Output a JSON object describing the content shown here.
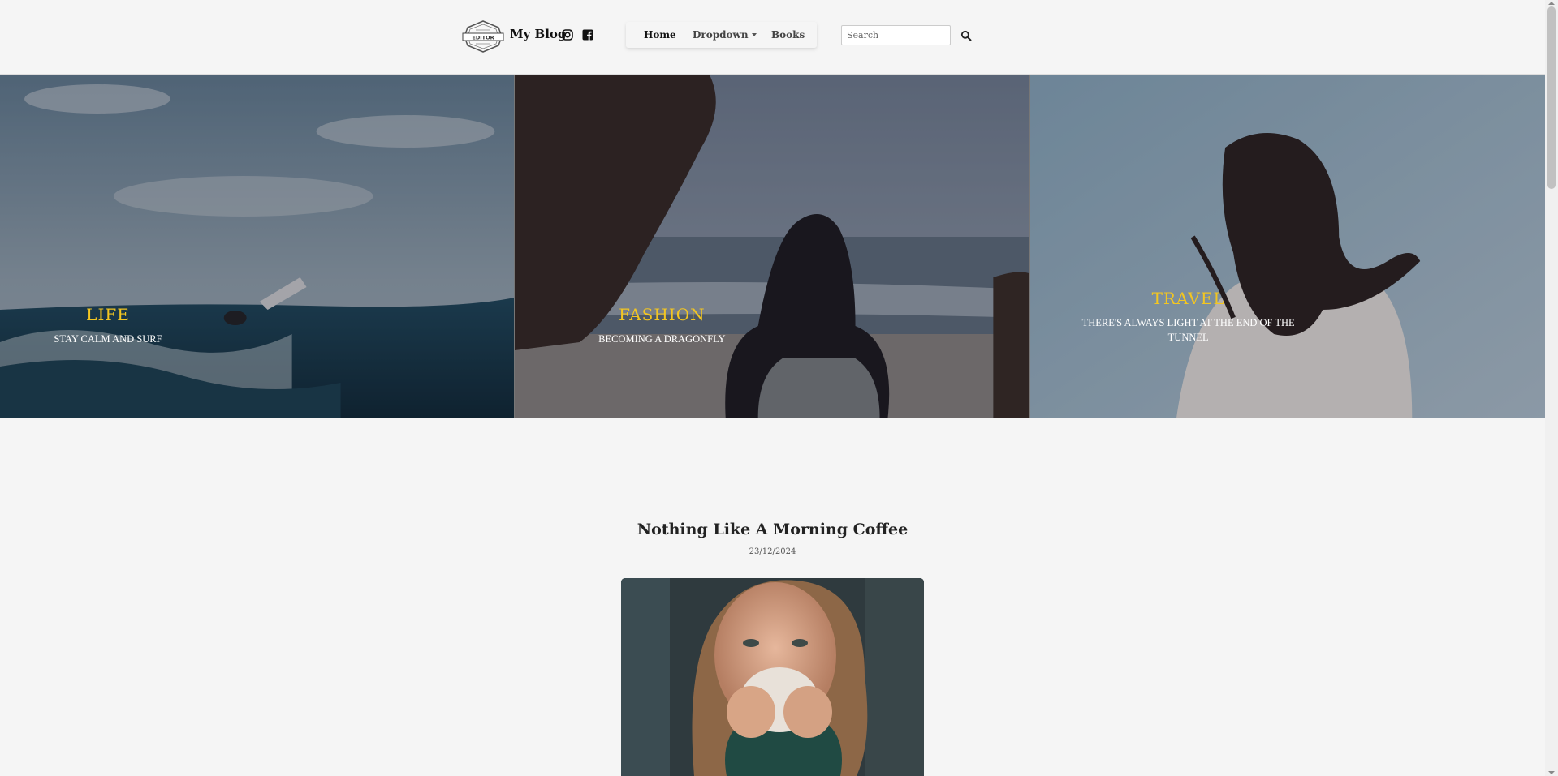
{
  "header": {
    "brand": "My Blog",
    "logo_text": "EDITOR",
    "icons": [
      "instagram-icon",
      "facebook-icon",
      "search-icon"
    ],
    "nav": {
      "home": "Home",
      "dropdown": "Dropdown",
      "books": "Books"
    },
    "search": {
      "placeholder": "Search",
      "value": ""
    }
  },
  "hero": {
    "panels": [
      {
        "category": "LIFE",
        "subtitle": "STAY CALM AND SURF"
      },
      {
        "category": "FASHION",
        "subtitle": "BECOMING A DRAGONFLY"
      },
      {
        "category": "TRAVEL",
        "subtitle": "THERE'S ALWAYS LIGHT AT THE END OF THE TUNNEL"
      }
    ]
  },
  "post": {
    "title": "Nothing Like A Morning Coffee",
    "date": "23/12/2024"
  },
  "colors": {
    "accent": "#f3c621",
    "background": "#f5f5f5"
  }
}
